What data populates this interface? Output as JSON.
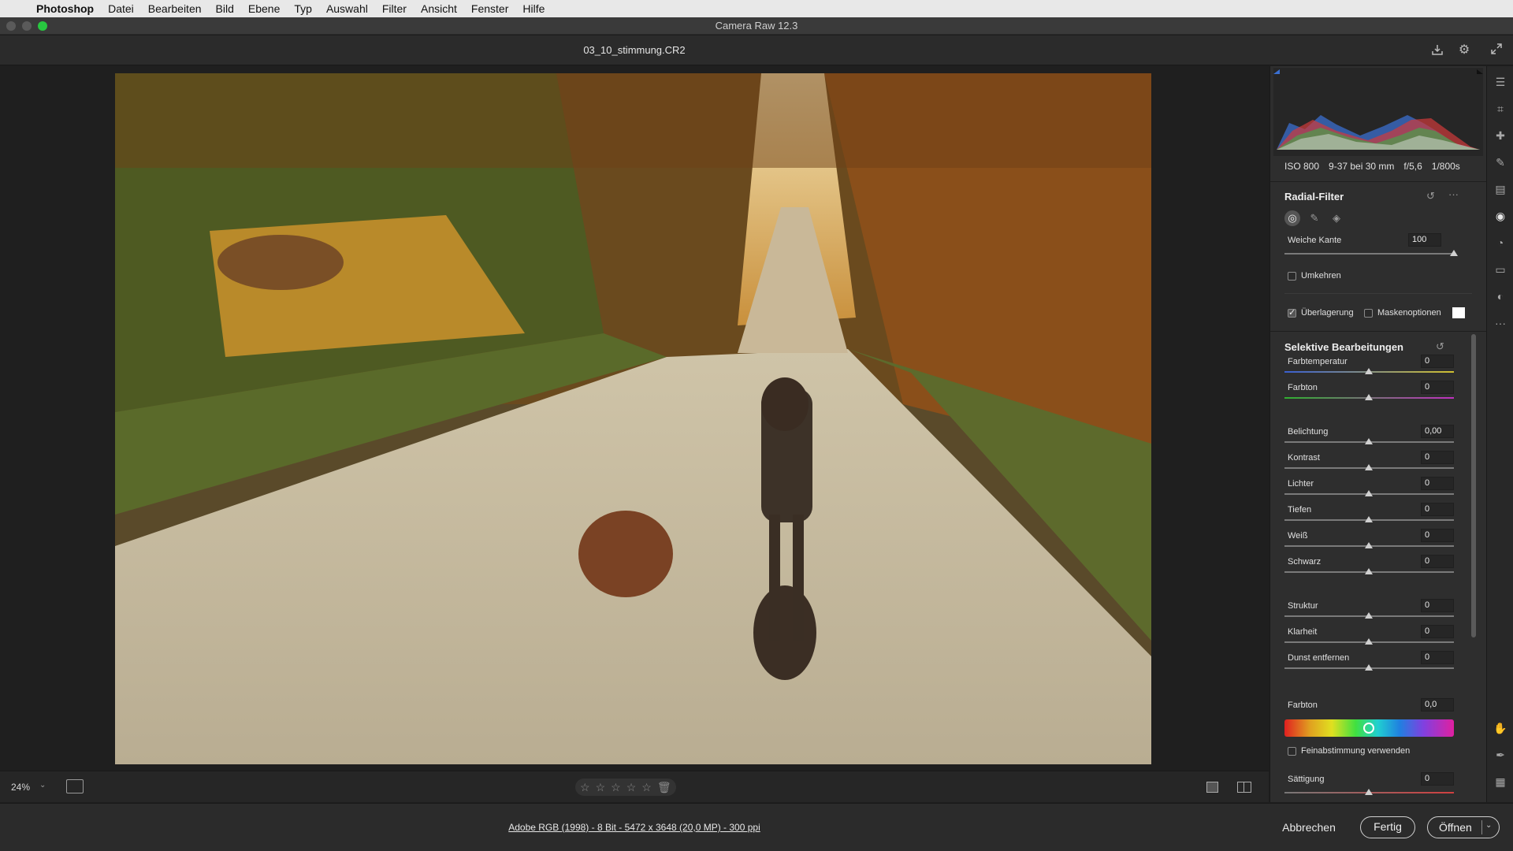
{
  "menubar": {
    "apple": "",
    "app_name": "Photoshop",
    "items": [
      "Datei",
      "Bearbeiten",
      "Bild",
      "Ebene",
      "Typ",
      "Auswahl",
      "Filter",
      "Ansicht",
      "Fenster",
      "Hilfe"
    ]
  },
  "window": {
    "title": "Camera Raw 12.3"
  },
  "header": {
    "filename": "03_10_stimmung.CR2",
    "icons": [
      "save-icon",
      "gear-icon",
      "fullscreen-icon"
    ]
  },
  "bottombar": {
    "zoom": "24%",
    "rating_stars": 5,
    "star_glyph": "☆",
    "trash_glyph": "🗑"
  },
  "footer": {
    "file_info": "Adobe RGB (1998) - 8 Bit - 5472 x 3648 (20,0 MP) - 300 ppi",
    "cancel": "Abbrechen",
    "done": "Fertig",
    "open": "Öffnen"
  },
  "panel": {
    "exif": {
      "iso": "ISO 800",
      "lens": "9-37 bei 30 mm",
      "aperture": "f/5,6",
      "shutter": "1/800s"
    },
    "radial_filter": {
      "title": "Radial-Filter",
      "feather_label": "Weiche Kante",
      "feather_value": "100",
      "feather_fraction": 1.0,
      "invert_label": "Umkehren",
      "invert_checked": false,
      "overlay_label": "Überlagerung",
      "overlay_checked": true,
      "mask_options_label": "Maskenoptionen",
      "mask_options_checked": false
    },
    "selective": {
      "title": "Selektive Bearbeitungen",
      "sliders": [
        {
          "label": "Farbtemperatur",
          "value": "0"
        },
        {
          "label": "Farbton",
          "value": "0"
        },
        {
          "label": "Belichtung",
          "value": "0,00"
        },
        {
          "label": "Kontrast",
          "value": "0"
        },
        {
          "label": "Lichter",
          "value": "0"
        },
        {
          "label": "Tiefen",
          "value": "0"
        },
        {
          "label": "Weiß",
          "value": "0"
        },
        {
          "label": "Schwarz",
          "value": "0"
        },
        {
          "label": "Struktur",
          "value": "0"
        },
        {
          "label": "Klarheit",
          "value": "0"
        },
        {
          "label": "Dunst entfernen",
          "value": "0"
        }
      ],
      "hue_label": "Farbton",
      "hue_value": "0,0",
      "fine_tune_label": "Feinabstimmung verwenden",
      "fine_tune_checked": false,
      "saturation_label": "Sättigung",
      "saturation_value": "0"
    }
  },
  "colors": {
    "temp_track_start": "#3a5fd0",
    "temp_track_end": "#d0c030",
    "tint_track_start": "#30b030",
    "tint_track_end": "#c030c0",
    "accent": "#ffffff"
  }
}
